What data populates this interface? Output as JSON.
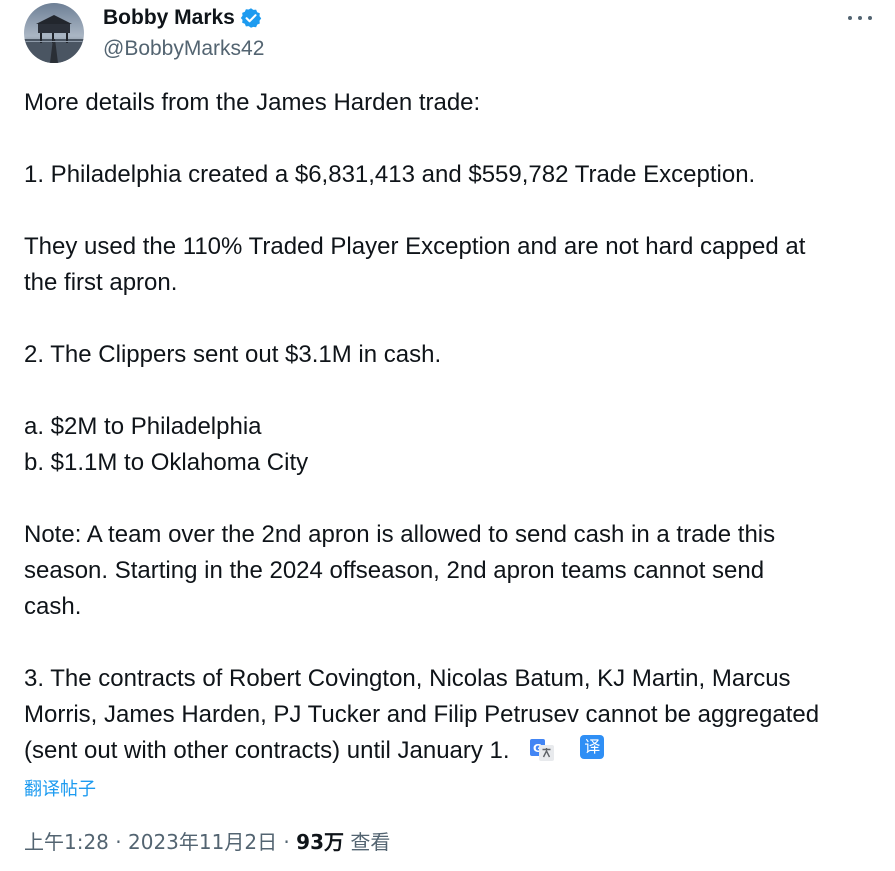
{
  "author": {
    "name": "Bobby Marks",
    "handle": "@BobbyMarks42",
    "verified": true,
    "verified_color": "#1d9bf0"
  },
  "menu_icon": "more-horizontal-icon",
  "tweet": {
    "lines": {
      "intro": "More details from the James Harden trade:",
      "p1": "1. Philadelphia created a $6,831,413 and $559,782 Trade Exception.",
      "p2a": "They used the 110% Traded Player Exception and are not hard capped at",
      "p2b": "the first apron.",
      "p3": "2. The Clippers sent out $3.1M in cash.",
      "p4a": "a. $2M to Philadelphia",
      "p4b": "b. $1.1M to Oklahoma City",
      "p5a": "Note: A team over the 2nd apron is allowed to send cash in a trade this",
      "p5b": "season. Starting in the 2024 offseason, 2nd apron teams cannot send",
      "p5c": "cash.",
      "p6a": "3. The contracts of Robert Covington, Nicolas Batum, KJ Martin, Marcus",
      "p6b": "Morris, James Harden, PJ Tucker and Filip Petrusev cannot be aggregated",
      "p6c": "(sent out with other contracts) until January 1."
    },
    "translate_badge_char": "译"
  },
  "translate_link": "翻译帖子",
  "meta": {
    "time": "上午1:28",
    "sep": " · ",
    "date": "2023年11月2日",
    "views_count": "93万",
    "views_label": " 查看"
  },
  "colors": {
    "text": "#0f1419",
    "secondary": "#536471",
    "link": "#1d9bf0"
  }
}
